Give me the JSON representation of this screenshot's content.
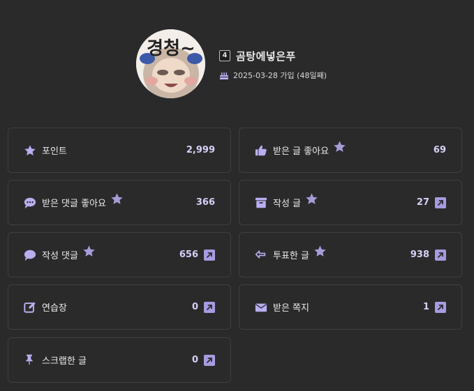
{
  "profile": {
    "level": "4",
    "nickname": "곰탕에넣은푸",
    "join_text": "2025-03-28 가입 (48일째)",
    "avatar_text": "경청~"
  },
  "stats": [
    {
      "id": "points",
      "icon": "star-icon",
      "label": "포인트",
      "value": "2,999",
      "has_star": false,
      "has_link": false
    },
    {
      "id": "received-post-likes",
      "icon": "thumbs-up-icon",
      "label": "받은 글 좋아요",
      "value": "69",
      "has_star": true,
      "has_link": false
    },
    {
      "id": "received-comment-likes",
      "icon": "comment-dots-icon",
      "label": "받은 댓글 좋아요",
      "value": "366",
      "has_star": true,
      "has_link": false
    },
    {
      "id": "written-posts",
      "icon": "archive-icon",
      "label": "작성 글",
      "value": "27",
      "has_star": true,
      "has_link": true
    },
    {
      "id": "written-comments",
      "icon": "comment-icon",
      "label": "작성 댓글",
      "value": "656",
      "has_star": true,
      "has_link": true
    },
    {
      "id": "voted-posts",
      "icon": "arrow-left-icon",
      "label": "투표한 글",
      "value": "938",
      "has_star": true,
      "has_link": true
    },
    {
      "id": "practice",
      "icon": "edit-icon",
      "label": "연습장",
      "value": "0",
      "has_star": false,
      "has_link": true
    },
    {
      "id": "received-messages",
      "icon": "envelope-icon",
      "label": "받은 쪽지",
      "value": "1",
      "has_star": false,
      "has_link": true
    },
    {
      "id": "scrapped-posts",
      "icon": "pin-icon",
      "label": "스크랩한 글",
      "value": "0",
      "has_star": false,
      "has_link": true
    }
  ],
  "colors": {
    "accent": "#b8aef0",
    "accent_dark": "#a79be0",
    "card_border": "#3f3f41",
    "background": "#2a2a2b"
  }
}
